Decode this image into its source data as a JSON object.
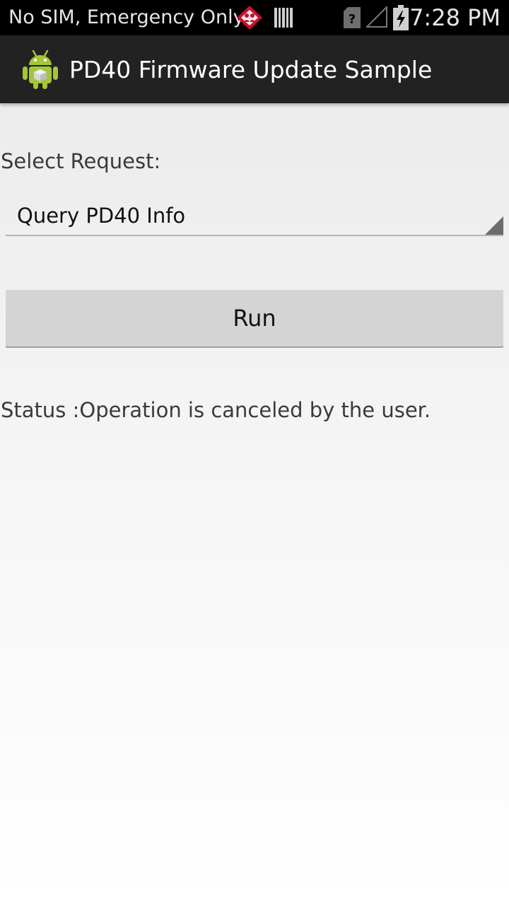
{
  "status_bar": {
    "carrier": "No SIM, Emergency Only",
    "time": "7:28 PM",
    "icons": [
      "alert-diamond-icon",
      "barcode-scanner-icon",
      "no-sim-icon",
      "no-signal-icon",
      "battery-charging-icon"
    ],
    "alert_color": "#c8102e"
  },
  "action_bar": {
    "title": "PD40 Firmware Update Sample",
    "icon": "android-app-icon",
    "android_green": "#a4c639"
  },
  "form": {
    "select_label": "Select Request:",
    "selected_request": "Query PD40 Info",
    "run_label": "Run"
  },
  "status": {
    "text": "Status :Operation is canceled by the user."
  }
}
